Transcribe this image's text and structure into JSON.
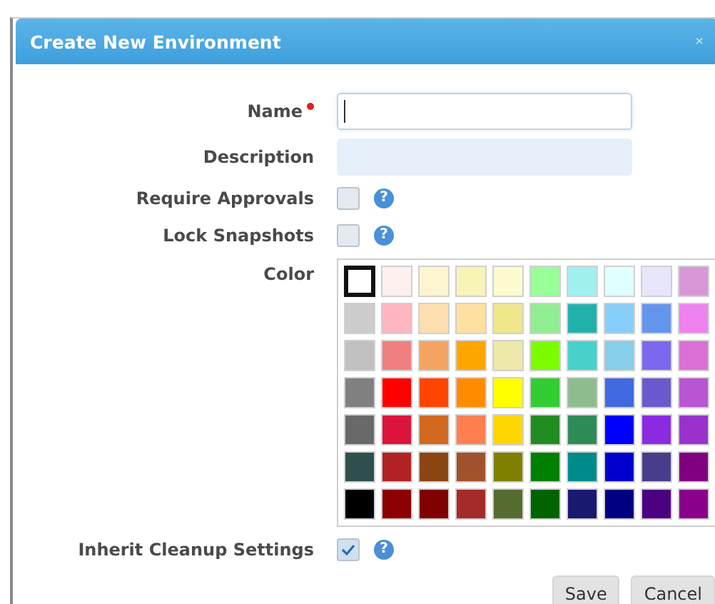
{
  "dialog": {
    "title": "Create New Environment",
    "close": "×"
  },
  "fields": [
    {
      "label": "Name",
      "required": true,
      "focused": true
    },
    {
      "label": "Description",
      "required": false,
      "focused": false
    }
  ],
  "options": [
    {
      "label": "Require Approvals",
      "checked": false,
      "help": "?"
    },
    {
      "label": "Lock Snapshots",
      "checked": false,
      "help": "?"
    }
  ],
  "color": {
    "label": "Color",
    "rows": [
      [
        {
          "color": "#ffffff",
          "selected": true
        },
        {
          "color": "#fff0f0",
          "selected": false
        },
        {
          "color": "#fdf5d0",
          "selected": false
        },
        {
          "color": "#f8f4b8",
          "selected": false
        },
        {
          "color": "#fefbd0",
          "selected": false
        },
        {
          "color": "#99ff99",
          "selected": false
        },
        {
          "color": "#a0f0f0",
          "selected": false
        },
        {
          "color": "#e0ffff",
          "selected": false
        },
        {
          "color": "#e8e6fa",
          "selected": false
        },
        {
          "color": "#d898d8",
          "selected": false
        }
      ],
      [
        {
          "color": "#cccccc",
          "selected": false
        },
        {
          "color": "#ffb6c1",
          "selected": false
        },
        {
          "color": "#ffdeb0",
          "selected": false
        },
        {
          "color": "#ffe0a0",
          "selected": false
        },
        {
          "color": "#f0e68c",
          "selected": false
        },
        {
          "color": "#90ee90",
          "selected": false
        },
        {
          "color": "#20b2aa",
          "selected": false
        },
        {
          "color": "#87cefa",
          "selected": false
        },
        {
          "color": "#6495ed",
          "selected": false
        },
        {
          "color": "#ee82ee",
          "selected": false
        }
      ],
      [
        {
          "color": "#c0c0c0",
          "selected": false
        },
        {
          "color": "#f08080",
          "selected": false
        },
        {
          "color": "#f4a460",
          "selected": false
        },
        {
          "color": "#ffa500",
          "selected": false
        },
        {
          "color": "#eee8aa",
          "selected": false
        },
        {
          "color": "#7cfc00",
          "selected": false
        },
        {
          "color": "#48d1cc",
          "selected": false
        },
        {
          "color": "#87ceeb",
          "selected": false
        },
        {
          "color": "#7b68ee",
          "selected": false
        },
        {
          "color": "#da70d6",
          "selected": false
        }
      ],
      [
        {
          "color": "#808080",
          "selected": false
        },
        {
          "color": "#ff0000",
          "selected": false
        },
        {
          "color": "#ff4500",
          "selected": false
        },
        {
          "color": "#ff8c00",
          "selected": false
        },
        {
          "color": "#ffff00",
          "selected": false
        },
        {
          "color": "#32cd32",
          "selected": false
        },
        {
          "color": "#8fbc8f",
          "selected": false
        },
        {
          "color": "#4169e1",
          "selected": false
        },
        {
          "color": "#6a5acd",
          "selected": false
        },
        {
          "color": "#ba55d3",
          "selected": false
        }
      ],
      [
        {
          "color": "#696969",
          "selected": false
        },
        {
          "color": "#dc143c",
          "selected": false
        },
        {
          "color": "#d2691e",
          "selected": false
        },
        {
          "color": "#ff7f50",
          "selected": false
        },
        {
          "color": "#ffd700",
          "selected": false
        },
        {
          "color": "#228b22",
          "selected": false
        },
        {
          "color": "#2e8b57",
          "selected": false
        },
        {
          "color": "#0000ff",
          "selected": false
        },
        {
          "color": "#8a2be2",
          "selected": false
        },
        {
          "color": "#9932cc",
          "selected": false
        }
      ],
      [
        {
          "color": "#2f4f4f",
          "selected": false
        },
        {
          "color": "#b22222",
          "selected": false
        },
        {
          "color": "#8b4513",
          "selected": false
        },
        {
          "color": "#a0522d",
          "selected": false
        },
        {
          "color": "#808000",
          "selected": false
        },
        {
          "color": "#008000",
          "selected": false
        },
        {
          "color": "#008b8b",
          "selected": false
        },
        {
          "color": "#0000cd",
          "selected": false
        },
        {
          "color": "#483d8b",
          "selected": false
        },
        {
          "color": "#800080",
          "selected": false
        }
      ],
      [
        {
          "color": "#000000",
          "selected": false
        },
        {
          "color": "#8b0000",
          "selected": false
        },
        {
          "color": "#800000",
          "selected": false
        },
        {
          "color": "#a52a2a",
          "selected": false
        },
        {
          "color": "#556b2f",
          "selected": false
        },
        {
          "color": "#006400",
          "selected": false
        },
        {
          "color": "#191970",
          "selected": false
        },
        {
          "color": "#000080",
          "selected": false
        },
        {
          "color": "#4b0082",
          "selected": false
        },
        {
          "color": "#8b008b",
          "selected": false
        }
      ]
    ]
  },
  "inherit": {
    "label": "Inherit Cleanup Settings",
    "checked": true,
    "help": "?"
  },
  "buttons": [
    "Save",
    "Cancel"
  ]
}
